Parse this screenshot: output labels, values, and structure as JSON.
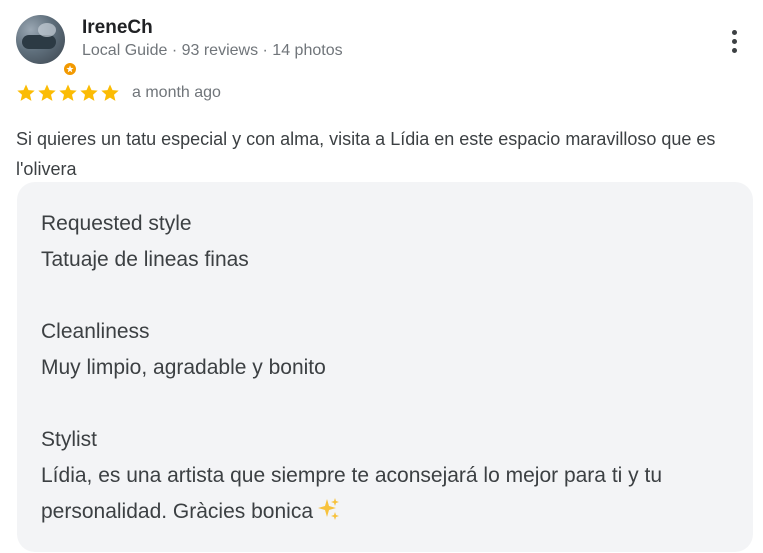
{
  "reviewer": {
    "name": "IreneCh",
    "meta": "Local Guide · 93 reviews · 14 photos"
  },
  "rating": {
    "stars": 5,
    "max": 5,
    "time": "a month ago"
  },
  "review": {
    "text": "Si quieres un tatu especial y con alma, visita a Lídia en este espacio maravilloso que es l'olivera"
  },
  "attributes": [
    {
      "label": "Requested style",
      "value": "Tatuaje de lineas finas"
    },
    {
      "label": "Cleanliness",
      "value": "Muy limpio, agradable y bonito"
    },
    {
      "label": "Stylist",
      "value": "Lídia, es una artista que siempre te aconsejará lo mejor para ti y tu personalidad. Gràcies bonica"
    }
  ],
  "colors": {
    "star": "#fbbc04",
    "badge": "#f29900",
    "panel": "#f3f4f6",
    "meta_text": "#70757a"
  },
  "icons": {
    "more": "more-vert-icon",
    "badge": "local-guide-badge-icon",
    "sparkle": "sparkles-emoji-icon",
    "star": "star-icon"
  }
}
